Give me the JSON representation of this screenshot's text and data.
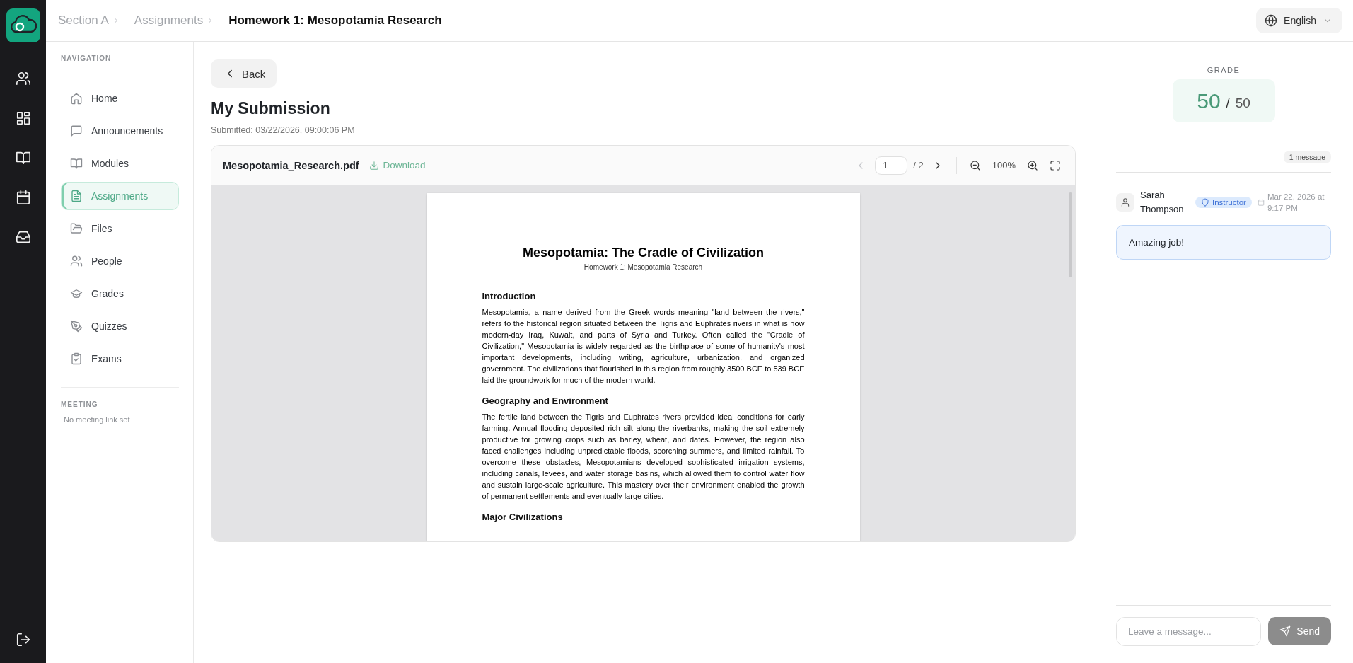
{
  "breadcrumb": [
    {
      "label": "Section A",
      "current": false
    },
    {
      "label": "Assignments",
      "current": false
    },
    {
      "label": "Homework 1: Mesopotamia Research",
      "current": true
    }
  ],
  "language": "English",
  "sidebar": {
    "nav_heading": "NAVIGATION",
    "items": [
      {
        "label": "Home",
        "selected": false
      },
      {
        "label": "Announcements",
        "selected": false
      },
      {
        "label": "Modules",
        "selected": false
      },
      {
        "label": "Assignments",
        "selected": true
      },
      {
        "label": "Files",
        "selected": false
      },
      {
        "label": "People",
        "selected": false
      },
      {
        "label": "Grades",
        "selected": false
      },
      {
        "label": "Quizzes",
        "selected": false
      },
      {
        "label": "Exams",
        "selected": false
      }
    ],
    "meeting_heading": "MEETING",
    "meeting_text": "No meeting link set"
  },
  "submission": {
    "back": "Back",
    "title": "My Submission",
    "submitted": "Submitted: 03/22/2026, 09:00:06 PM"
  },
  "viewer": {
    "file_name": "Mesopotamia_Research.pdf",
    "download": "Download",
    "prev_disabled": true,
    "next_disabled": false,
    "page": "1",
    "page_total": "/ 2",
    "zoom": "100%",
    "document": {
      "title": "Mesopotamia: The Cradle of Civilization",
      "subtitle": "Homework 1: Mesopotamia Research",
      "sections": [
        {
          "heading": "Introduction",
          "body": "Mesopotamia, a name derived from the Greek words meaning \"land between the rivers,\" refers to the historical region situated between the Tigris and Euphrates rivers in what is now modern-day Iraq, Kuwait, and parts of Syria and Turkey. Often called the \"Cradle of Civilization,\" Mesopotamia is widely regarded as the birthplace of some of humanity's most important developments, including writing, agriculture, urbanization, and organized government. The civilizations that flourished in this region from roughly 3500 BCE to 539 BCE laid the groundwork for much of the modern world."
        },
        {
          "heading": "Geography and Environment",
          "body": "The fertile land between the Tigris and Euphrates rivers provided ideal conditions for early farming. Annual flooding deposited rich silt along the riverbanks, making the soil extremely productive for growing crops such as barley, wheat, and dates. However, the region also faced challenges including unpredictable floods, scorching summers, and limited rainfall. To overcome these obstacles, Mesopotamians developed sophisticated irrigation systems, including canals, levees, and water storage basins, which allowed them to control water flow and sustain large-scale agriculture. This mastery over their environment enabled the growth of permanent settlements and eventually large cities."
        },
        {
          "heading": "Major Civilizations"
        }
      ]
    }
  },
  "grade": {
    "label": "GRADE",
    "score": "50",
    "separator": "/",
    "total": "50"
  },
  "comments": {
    "count": "1 message",
    "messages": [
      {
        "author": "Sarah Thompson",
        "role": "Instructor",
        "time": "Mar 22, 2026 at 9:17 PM",
        "text": "Amazing job!"
      }
    ],
    "placeholder": "Leave a message...",
    "send": "Send",
    "send_disabled": true
  }
}
